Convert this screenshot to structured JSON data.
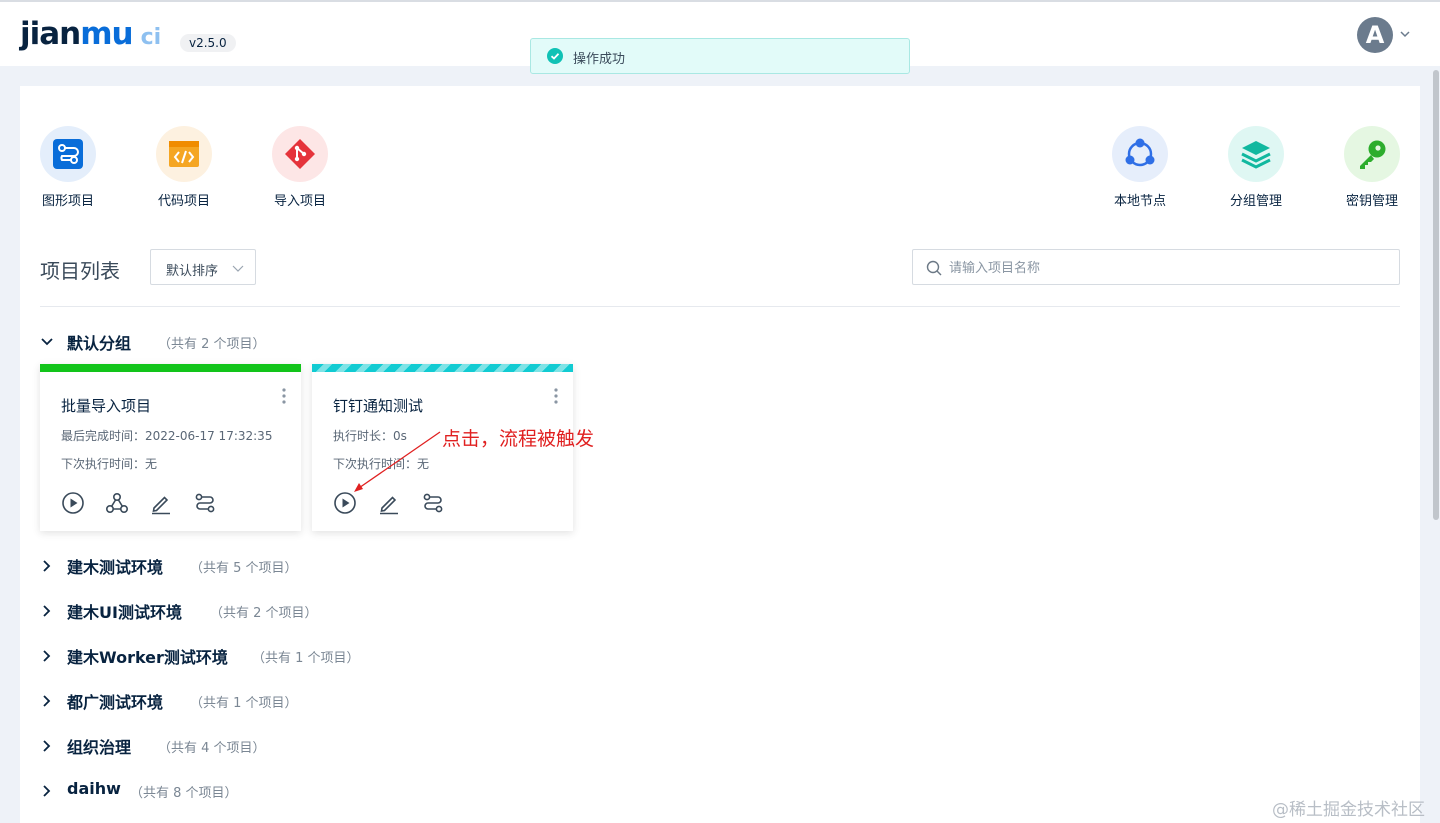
{
  "header": {
    "logo_main": "jian",
    "logo_accent": "mu",
    "logo_suffix": "ci",
    "version": "v2.5.0",
    "avatar_letter": "A"
  },
  "toast": {
    "message": "操作成功"
  },
  "quick_actions_left": [
    {
      "label": "图形项目",
      "icon": "graph-project-icon",
      "bg": "#e4eefb",
      "color": "#096dd9"
    },
    {
      "label": "代码项目",
      "icon": "code-project-icon",
      "bg": "#fdf1e0",
      "color": "#f5a623"
    },
    {
      "label": "导入项目",
      "icon": "git-import-icon",
      "bg": "#fde6e6",
      "color": "#e5333b"
    }
  ],
  "quick_actions_right": [
    {
      "label": "本地节点",
      "icon": "local-node-icon",
      "bg": "#e6eefb",
      "color": "#2f6fe6"
    },
    {
      "label": "分组管理",
      "icon": "group-layers-icon",
      "bg": "#dff7f3",
      "color": "#11b89f"
    },
    {
      "label": "密钥管理",
      "icon": "key-icon",
      "bg": "#e5f7e2",
      "color": "#2dad2d"
    }
  ],
  "list": {
    "title": "项目列表",
    "sort_label": "默认排序",
    "search_placeholder": "请输入项目名称"
  },
  "groups": [
    {
      "name": "默认分组",
      "count": "（共有 2 个项目）",
      "expanded": true
    },
    {
      "name": "建木测试环境",
      "count": "（共有 5 个项目）",
      "expanded": false
    },
    {
      "name": "建木UI测试环境",
      "count": "（共有 2 个项目）",
      "expanded": false
    },
    {
      "name": "建木Worker测试环境",
      "count": "（共有 1 个项目）",
      "expanded": false
    },
    {
      "name": "都广测试环境",
      "count": "（共有 1 个项目）",
      "expanded": false
    },
    {
      "name": "组织治理",
      "count": "（共有 4 个项目）",
      "expanded": false
    },
    {
      "name": "daihw",
      "count": "（共有 8 个项目）",
      "expanded": false
    }
  ],
  "projects": [
    {
      "name": "批量导入项目",
      "meta1": "最后完成时间：2022-06-17 17:32:35",
      "meta2": "下次执行时间：无",
      "status_color": "#12c41a"
    },
    {
      "name": "钉钉通知测试",
      "meta1": "执行时长：0s",
      "meta2": "下次执行时间：无",
      "status_color": "#11cbd2"
    }
  ],
  "annotation": {
    "text": "点击，流程被触发",
    "color": "#e02020"
  },
  "watermark": "@稀土掘金技术社区"
}
